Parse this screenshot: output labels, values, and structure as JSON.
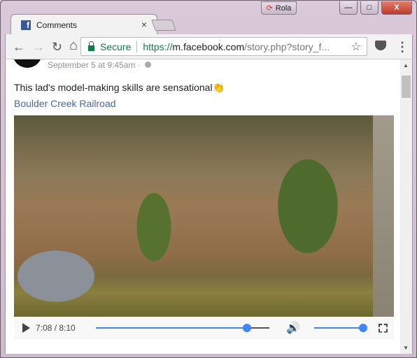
{
  "window": {
    "profile_name": "Rola",
    "minimize": "—",
    "maximize": "□",
    "close": "X"
  },
  "tab": {
    "title": "Comments",
    "close": "×",
    "favicon": "facebook-icon"
  },
  "toolbar": {
    "back": "←",
    "forward": "→",
    "reload": "↻",
    "home": "⌂",
    "security_label": "Secure",
    "url_scheme": "https://",
    "url_host": "m.facebook.com",
    "url_path": "/story.php?story_f...",
    "star": "☆",
    "menu": "⋮"
  },
  "post": {
    "date": "September 5 at 9:45am · ",
    "message": "This lad's model-making skills are sensational👏",
    "page_link": "Boulder Creek Railroad"
  },
  "video": {
    "time": "7:08 / 8:10",
    "progress_percent": 87,
    "volume_percent": 100,
    "accent": "#4285f4"
  }
}
